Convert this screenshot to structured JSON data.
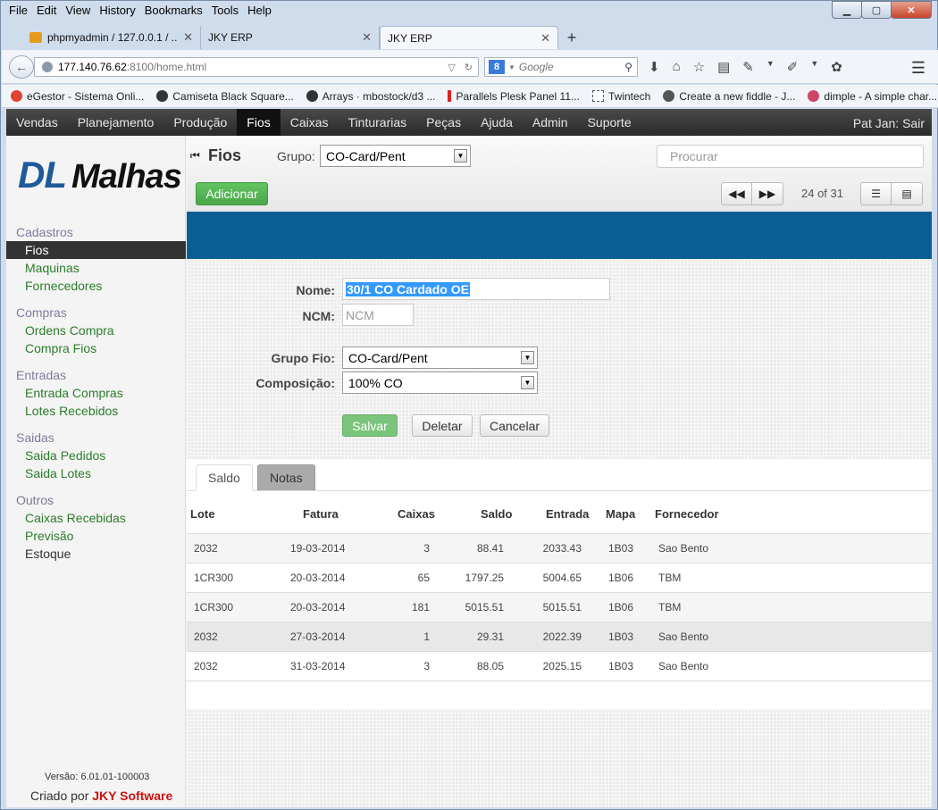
{
  "browser": {
    "menu": [
      "File",
      "Edit",
      "View",
      "History",
      "Bookmarks",
      "Tools",
      "Help"
    ],
    "tabs": [
      {
        "title": "phpmyadmin / 127.0.0.1 / ..."
      },
      {
        "title": "JKY ERP"
      },
      {
        "title": "JKY ERP"
      }
    ],
    "url_host": "177.140.76.62",
    "url_rest": ":8100/home.html",
    "search_placeholder": "Google",
    "bookmarks": [
      "eGestor - Sistema Onli...",
      "Camiseta Black Square...",
      "Arrays · mbostock/d3 ...",
      "Parallels Plesk Panel 11...",
      "Twintech",
      "Create a new fiddle - J...",
      "dimple - A simple char..."
    ]
  },
  "app": {
    "topnav": [
      "Vendas",
      "Planejamento",
      "Produção",
      "Fios",
      "Caixas",
      "Tinturarias",
      "Peças",
      "Ajuda",
      "Admin",
      "Suporte"
    ],
    "active_nav": "Fios",
    "user": "Pat Jan:",
    "logout": "Sair",
    "logo_dl": "DL",
    "logo_malhas": "Malhas",
    "sidebar": {
      "groups": [
        {
          "title": "Cadastros",
          "items": [
            "Fios",
            "Maquinas",
            "Fornecedores"
          ]
        },
        {
          "title": "Compras",
          "items": [
            "Ordens Compra",
            "Compra Fios"
          ]
        },
        {
          "title": "Entradas",
          "items": [
            "Entrada Compras",
            "Lotes Recebidos"
          ]
        },
        {
          "title": "Saidas",
          "items": [
            "Saida Pedidos",
            "Saida Lotes"
          ]
        },
        {
          "title": "Outros",
          "items": [
            "Caixas Recebidas",
            "Previsão",
            "Estoque"
          ]
        }
      ],
      "version": "Versão: 6.01.01-100003",
      "credit_prefix": "Criado por",
      "credit_name": "JKY Software"
    },
    "header": {
      "title": "Fios",
      "grupo_label": "Grupo:",
      "grupo_value": "CO-Card/Pent",
      "search_placeholder": "Procurar",
      "add_button": "Adicionar",
      "pager": "24 of 31"
    },
    "form": {
      "nome_label": "Nome:",
      "nome_value": "30/1 CO Cardado OE",
      "ncm_label": "NCM:",
      "ncm_placeholder": "NCM",
      "grupo_fio_label": "Grupo Fio:",
      "grupo_fio_value": "CO-Card/Pent",
      "composicao_label": "Composição:",
      "composicao_value": "100% CO",
      "save": "Salvar",
      "delete": "Deletar",
      "cancel": "Cancelar"
    },
    "detail_tabs": [
      "Saldo",
      "Notas"
    ],
    "table": {
      "headers": [
        "Lote",
        "Fatura",
        "Caixas",
        "Saldo",
        "Entrada",
        "Mapa",
        "Fornecedor"
      ],
      "rows": [
        [
          "2032",
          "19-03-2014",
          "3",
          "88.41",
          "2033.43",
          "1B03",
          "Sao Bento"
        ],
        [
          "1CR300",
          "20-03-2014",
          "65",
          "1797.25",
          "5004.65",
          "1B06",
          "TBM"
        ],
        [
          "1CR300",
          "20-03-2014",
          "181",
          "5015.51",
          "5015.51",
          "1B06",
          "TBM"
        ],
        [
          "2032",
          "27-03-2014",
          "1",
          "29.31",
          "2022.39",
          "1B03",
          "Sao Bento"
        ],
        [
          "2032",
          "31-03-2014",
          "3",
          "88.05",
          "2025.15",
          "1B03",
          "Sao Bento"
        ]
      ]
    }
  }
}
